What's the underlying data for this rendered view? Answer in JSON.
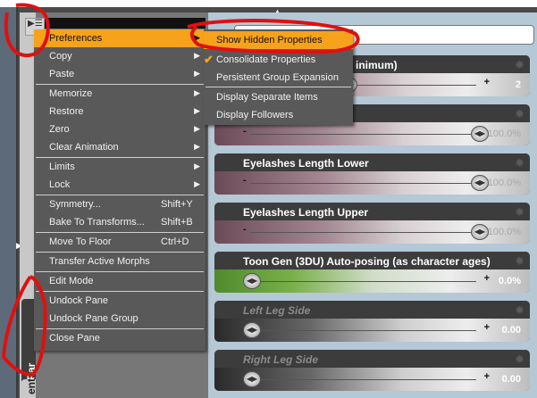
{
  "menu": {
    "items": [
      {
        "label": "Preferences",
        "submenu": true,
        "highlighted": true
      },
      {
        "label": "Copy",
        "submenu": true
      },
      {
        "label": "Paste",
        "submenu": true
      },
      {
        "label": "Memorize",
        "submenu": true
      },
      {
        "label": "Restore",
        "submenu": true
      },
      {
        "label": "Zero",
        "submenu": true
      },
      {
        "label": "Clear Animation",
        "submenu": true
      },
      {
        "label": "Limits",
        "submenu": true
      },
      {
        "label": "Lock",
        "submenu": true
      },
      {
        "label": "Symmetry...",
        "shortcut": "Shift+Y"
      },
      {
        "label": "Bake To Transforms...",
        "shortcut": "Shift+B"
      },
      {
        "label": "Move To Floor",
        "shortcut": "Ctrl+D"
      },
      {
        "label": "Transfer Active Morphs"
      },
      {
        "label": "Edit Mode"
      },
      {
        "label": "Undock Pane"
      },
      {
        "label": "Undock Pane Group"
      },
      {
        "label": "Close Pane"
      }
    ]
  },
  "submenu": {
    "items": [
      {
        "label": "Show Hidden Properties",
        "checked": true,
        "highlighted": true
      },
      {
        "label": "Consolidate Properties",
        "checked": true
      },
      {
        "label": "Persistent Group Expansion"
      },
      {
        "label": "Display Separate Items"
      },
      {
        "label": "Display Followers"
      }
    ]
  },
  "tabs": {
    "active": "Par",
    "other": "ent"
  },
  "properties": [
    {
      "title": "inimum)",
      "value": "2",
      "style": "pink"
    },
    {
      "title": "",
      "value": "100.0%",
      "style": "pink"
    },
    {
      "title": "Eyelashes Length Lower",
      "value": "100.0%",
      "style": "pink"
    },
    {
      "title": "Eyelashes Length Upper",
      "value": "100.0%",
      "style": "pink"
    },
    {
      "title": "Toon Gen (3DU) Auto-posing (as character ages)",
      "value": "0.0%",
      "style": "green"
    },
    {
      "title": "Left Leg Side",
      "value": "0.00",
      "style": "dark",
      "disabled": true
    },
    {
      "title": "Right Leg Side",
      "value": "0.00",
      "style": "dark",
      "disabled": true
    }
  ],
  "colors": {
    "highlight": "#f7a21b",
    "annotation": "#e01010",
    "panel": "#b4c8d6"
  }
}
